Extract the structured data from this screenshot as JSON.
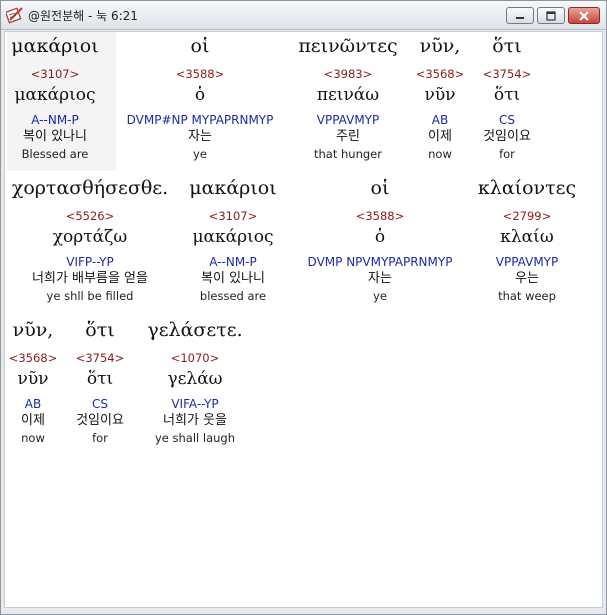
{
  "window": {
    "title": "@원전분해 - 눅 6:21",
    "icon": "book-pen-icon",
    "buttons": {
      "minimize": "minimize-icon",
      "maximize": "maximize-icon",
      "close": "close-icon"
    }
  },
  "words": [
    {
      "greek": "μακάριοι",
      "strong": "<3107>",
      "lemma": "μακάριος",
      "morph": "A--NM-P",
      "korean": "복이 있나니",
      "english": "Blessed are"
    },
    {
      "greek": "οἱ",
      "strong": "<3588>",
      "lemma": "ὁ",
      "morph": "DVMP#NP MYPAPRNMYP",
      "korean": "자는",
      "english": "ye"
    },
    {
      "greek": "πεινῶντες",
      "strong": "<3983>",
      "lemma": "πεινάω",
      "morph": "VPPAVMYP",
      "korean": "주린",
      "english": "that hunger"
    },
    {
      "greek": "νῦν,",
      "strong": "<3568>",
      "lemma": "νῦν",
      "morph": "AB",
      "korean": "이제",
      "english": "now"
    },
    {
      "greek": "ὅτι",
      "strong": "<3754>",
      "lemma": "ὅτι",
      "morph": "CS",
      "korean": "것임이요",
      "english": "for"
    },
    {
      "greek": "χορτασθήσεσθε.",
      "strong": "<5526>",
      "lemma": "χορτάζω",
      "morph": "VIFP--YP",
      "korean": "너희가 배부름을 얻을",
      "english": "ye shll be filled"
    },
    {
      "greek": "μακάριοι",
      "strong": "<3107>",
      "lemma": "μακάριος",
      "morph": "A--NM-P",
      "korean": "복이 있나니",
      "english": "blessed are"
    },
    {
      "greek": "οἱ",
      "strong": "<3588>",
      "lemma": "ὁ",
      "morph": "DVMP NPVMYPAPRNMYP",
      "korean": "자는",
      "english": "ye"
    },
    {
      "greek": "κλαίοντες",
      "strong": "<2799>",
      "lemma": "κλαίω",
      "morph": "VPPAVMYP",
      "korean": "우는",
      "english": "that weep"
    },
    {
      "greek": "νῦν,",
      "strong": "<3568>",
      "lemma": "νῦν",
      "morph": "AB",
      "korean": "이제",
      "english": "now"
    },
    {
      "greek": "ὅτι",
      "strong": "<3754>",
      "lemma": "ὅτι",
      "morph": "CS",
      "korean": "것임이요",
      "english": "for"
    },
    {
      "greek": "γελάσετε.",
      "strong": "<1070>",
      "lemma": "γελάω",
      "morph": "VIFA--YP",
      "korean": "너희가 웃을",
      "english": "ye shall laugh"
    }
  ]
}
